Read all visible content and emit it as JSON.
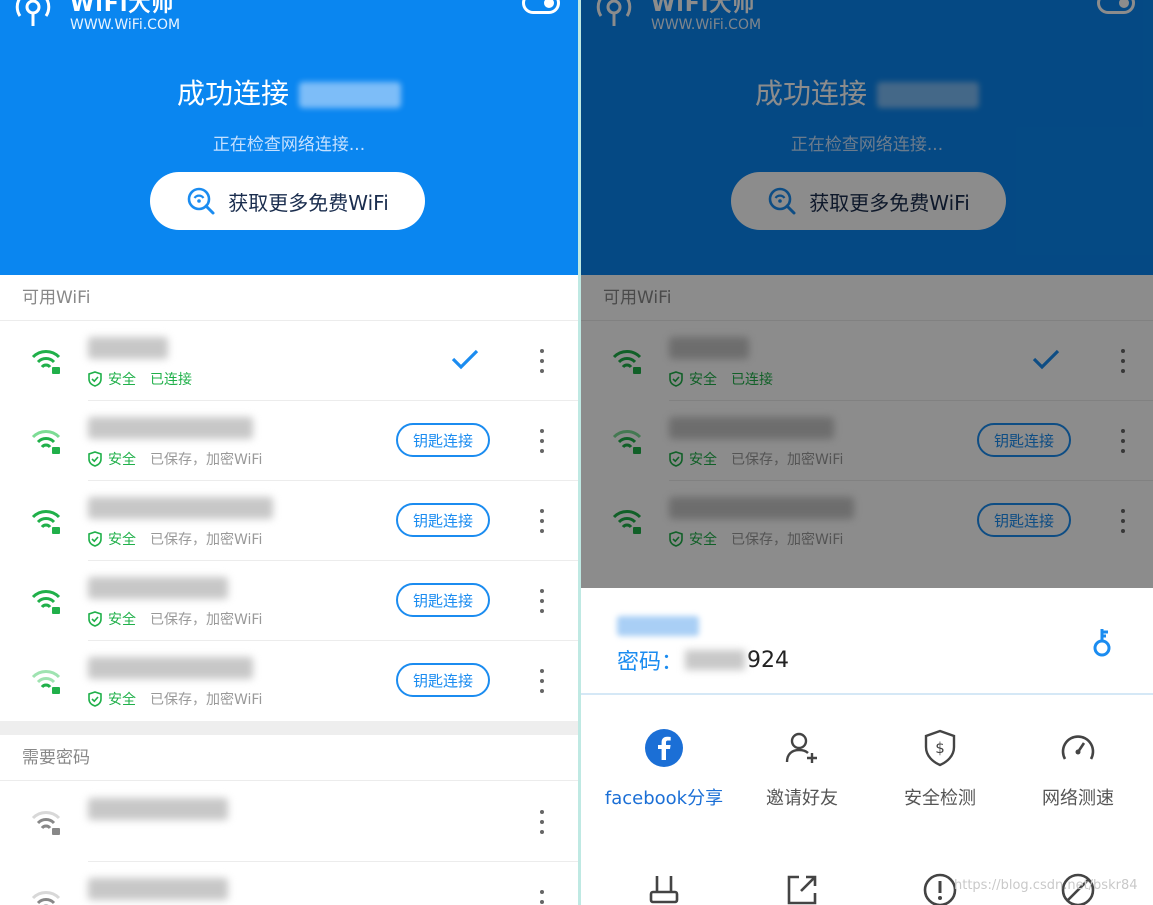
{
  "app": {
    "name": "WiFi大师",
    "url": "WWW.WiFi.COM"
  },
  "header": {
    "title": "成功连接",
    "checking": "正在检查网络连接...",
    "more_button": "获取更多免费WiFi"
  },
  "sections": {
    "available": "可用WiFi",
    "need_password": "需要密码"
  },
  "networks": [
    {
      "status": "安全",
      "detail": "已连接"
    },
    {
      "status": "安全",
      "detail": "已保存，加密WiFi",
      "action": "钥匙连接"
    },
    {
      "status": "安全",
      "detail": "已保存，加密WiFi",
      "action": "钥匙连接"
    },
    {
      "status": "安全",
      "detail": "已保存，加密WiFi",
      "action": "钥匙连接"
    },
    {
      "status": "安全",
      "detail": "已保存，加密WiFi",
      "action": "钥匙连接"
    }
  ],
  "sheet": {
    "password_label": "密码：",
    "password_tail": "924",
    "actions": [
      {
        "label": "facebook分享",
        "icon": "facebook-icon"
      },
      {
        "label": "邀请好友",
        "icon": "add-user-icon"
      },
      {
        "label": "安全检测",
        "icon": "shield-dollar-icon"
      },
      {
        "label": "网络测速",
        "icon": "speedometer-icon"
      },
      {
        "label": "",
        "icon": "router-icon"
      },
      {
        "label": "",
        "icon": "external-link-icon"
      },
      {
        "label": "",
        "icon": "alert-icon"
      },
      {
        "label": "",
        "icon": "block-icon"
      }
    ]
  },
  "watermark": "https://blog.csdn.net/bskr84",
  "colors": {
    "brand_blue": "#0a86f0",
    "secure_green": "#20b04a",
    "action_blue": "#1b8cf0"
  }
}
